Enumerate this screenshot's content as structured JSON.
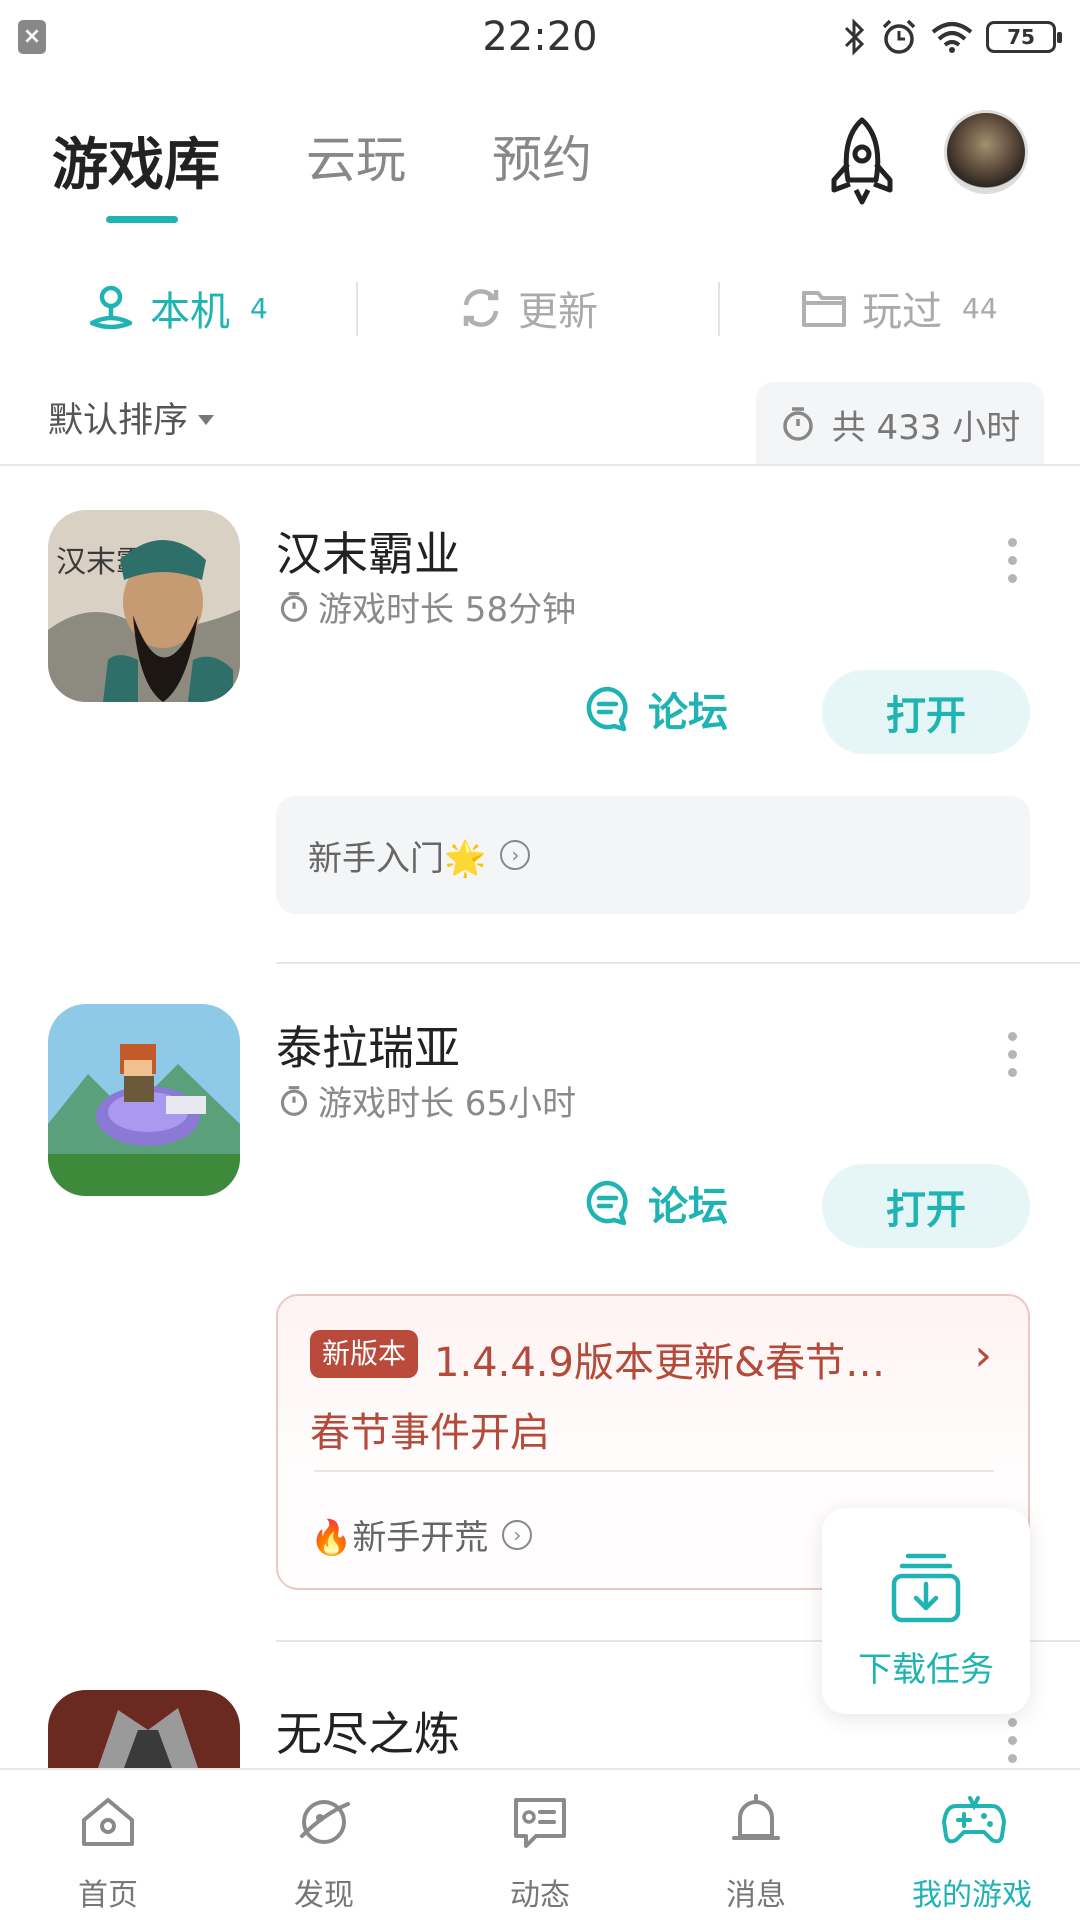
{
  "status_bar": {
    "time": "22:20",
    "battery": "75"
  },
  "header": {
    "tabs": [
      {
        "label": "游戏库",
        "active": true
      },
      {
        "label": "云玩",
        "active": false
      },
      {
        "label": "预约",
        "active": false
      }
    ]
  },
  "sub_tabs": [
    {
      "label": "本机",
      "count": "4",
      "active": true,
      "icon": "local-icon"
    },
    {
      "label": "更新",
      "count": "",
      "active": false,
      "icon": "refresh-icon"
    },
    {
      "label": "玩过",
      "count": "44",
      "active": false,
      "icon": "folder-icon"
    }
  ],
  "sort": {
    "label": "默认排序"
  },
  "total_playtime": "共 433 小时",
  "games": [
    {
      "title": "汉末霸业",
      "playtime": "游戏时长 58分钟",
      "forum_label": "论坛",
      "open_label": "打开",
      "guide": "新手入门🌟"
    },
    {
      "title": "泰拉瑞亚",
      "playtime": "游戏时长 65小时",
      "forum_label": "论坛",
      "open_label": "打开",
      "update_badge": "新版本",
      "update_title": "1.4.4.9版本更新&春节…",
      "update_sub": "春节事件开启",
      "guide": "🔥新手开荒"
    },
    {
      "title": "无尽之炼"
    }
  ],
  "download": {
    "label": "下载任务"
  },
  "bottom_nav": [
    {
      "label": "首页",
      "icon": "home-icon",
      "active": false
    },
    {
      "label": "发现",
      "icon": "discover-icon",
      "active": false
    },
    {
      "label": "动态",
      "icon": "feed-icon",
      "active": false
    },
    {
      "label": "消息",
      "icon": "bell-icon",
      "active": false
    },
    {
      "label": "我的游戏",
      "icon": "gamepad-icon",
      "active": true
    }
  ],
  "colors": {
    "accent": "#1fb3b3",
    "update_red": "#b34a3a"
  }
}
